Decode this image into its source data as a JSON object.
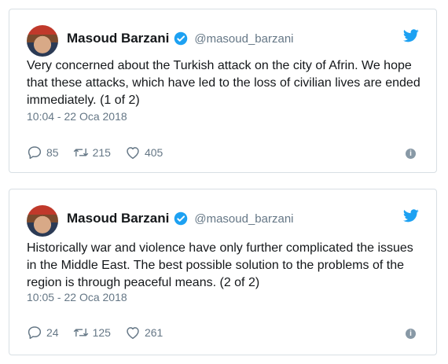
{
  "tweets": [
    {
      "name": "Masoud Barzani",
      "handle": "@masoud_barzani",
      "text": "Very concerned about the Turkish attack on the city of Afrin. We hope that these attacks, which have led to the loss of civilian lives are ended immediately.  (1 of 2)",
      "timestamp": "10:04 - 22 Oca 2018",
      "replies": "85",
      "retweets": "215",
      "likes": "405"
    },
    {
      "name": "Masoud Barzani",
      "handle": "@masoud_barzani",
      "text": "Historically war and violence have only further complicated the issues in the Middle East. The best possible solution to the problems of the region is through peaceful means. (2 of 2)",
      "timestamp": "10:05 - 22 Oca 2018",
      "replies": "24",
      "retweets": "125",
      "likes": "261"
    }
  ],
  "icons": {
    "brand": "twitter-bird-icon",
    "verified": "verified-badge-icon",
    "reply": "reply-icon",
    "retweet": "retweet-icon",
    "like": "heart-icon",
    "info": "info-icon"
  },
  "colors": {
    "twitter_blue": "#1da1f2",
    "muted_text": "#657786",
    "border": "#d8dfe4"
  }
}
